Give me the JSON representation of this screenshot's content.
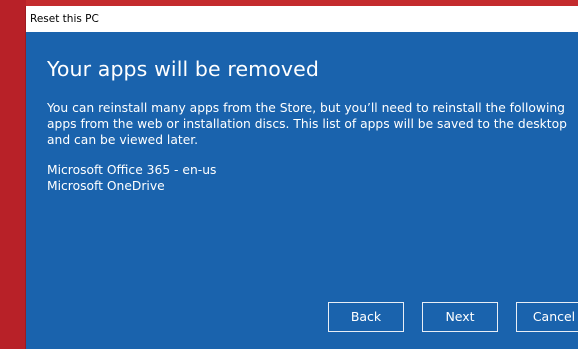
{
  "window": {
    "title": "Reset this PC"
  },
  "main": {
    "heading": "Your apps will be removed",
    "description": "You can reinstall many apps from the Store, but you’ll need to reinstall the following apps from the web or installation discs. This list of apps will be saved to the desktop and can be viewed later.",
    "apps": [
      "Microsoft Office 365 - en-us",
      "Microsoft OneDrive"
    ]
  },
  "buttons": {
    "back_label": "Back",
    "next_label": "Next",
    "cancel_label": "Cancel"
  },
  "colors": {
    "desktop_background": "#c42b2d",
    "dialog_background": "#1a63ad",
    "text": "#ffffff"
  }
}
